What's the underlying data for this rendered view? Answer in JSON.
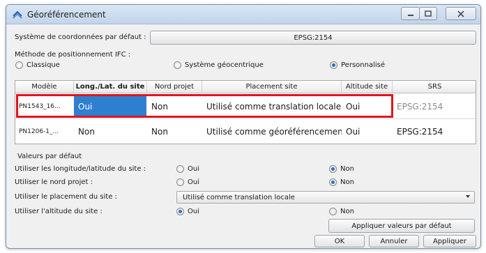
{
  "window": {
    "title": "Géoréférencement"
  },
  "coord_system": {
    "label": "Système de coordonnées par défaut :",
    "value": "EPSG:2154"
  },
  "method": {
    "label": "Méthode de positionnement IFC :",
    "options": [
      {
        "label": "Classique",
        "checked": false
      },
      {
        "label": "Système géocentrique",
        "checked": false
      },
      {
        "label": "Personnalisé",
        "checked": true
      }
    ]
  },
  "table": {
    "headers": [
      "Modèle",
      "Long./Lat. du site",
      "Nord projet",
      "Placement site",
      "Altitude site",
      "SRS"
    ],
    "rows": [
      {
        "model": "PN1543_16...",
        "longlat": "Oui",
        "north": "Non",
        "placement": "Utilisé comme translation locale",
        "altitude": "Oui",
        "srs": "EPSG:2154"
      },
      {
        "model": "PN1206-1_...",
        "longlat": "Non",
        "north": "Non",
        "placement": "Utilisé comme géoréférencement",
        "altitude": "Oui",
        "srs": "EPSG:2154"
      }
    ]
  },
  "defaults": {
    "title": "Valeurs par défaut",
    "longlat": {
      "label": "Utiliser les longitude/latitude du site :",
      "oui": "Oui",
      "non": "Non",
      "selected": "Non"
    },
    "north": {
      "label": "Utiliser le nord projet :",
      "oui": "Oui",
      "non": "Non",
      "selected": "Non"
    },
    "placement": {
      "label": "Utiliser le placement du site :",
      "value": "Utilisé comme translation locale"
    },
    "altitude": {
      "label": "Utiliser l'altitude du site :",
      "oui": "Oui",
      "non": "Non",
      "selected": "Oui"
    },
    "apply_defaults_button": "Appliquer valeurs par défaut"
  },
  "buttons": {
    "ok": "OK",
    "cancel": "Annuler",
    "apply": "Appliquer"
  },
  "colors": {
    "selection": "#2f7fd1",
    "highlight": "#e0141e"
  },
  "icons": {
    "app": "globe-icon",
    "minimize": "minimize-icon",
    "maximize": "maximize-icon",
    "close": "close-icon",
    "dropdown": "chevron-down-icon"
  }
}
